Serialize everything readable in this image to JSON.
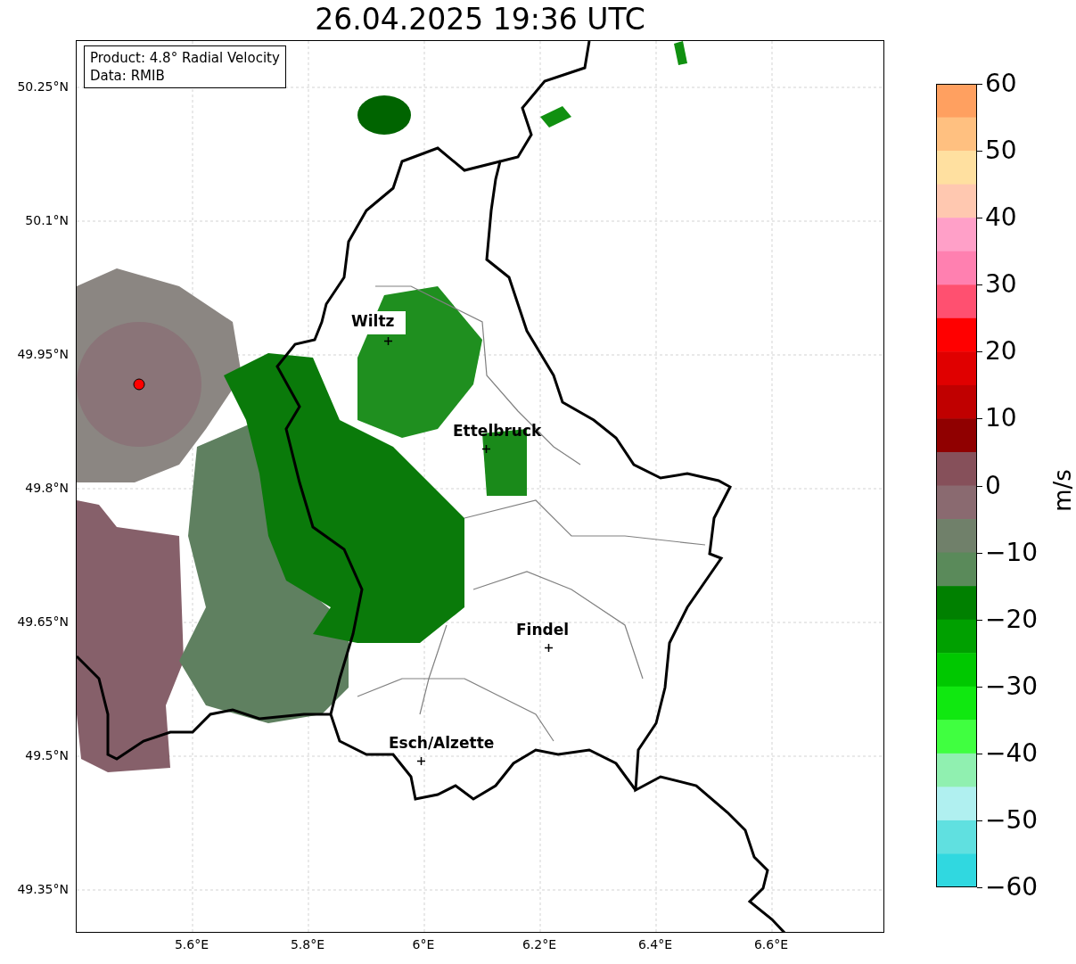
{
  "title": "26.04.2025 19:36 UTC",
  "legend": {
    "lines": [
      "Product: 4.8° Radial Velocity",
      "Data: RMIB"
    ]
  },
  "map": {
    "cities": [
      {
        "name": "Wiltz"
      },
      {
        "name": "Ettelbruck"
      },
      {
        "name": "Findel"
      },
      {
        "name": "Esch/Alzette"
      }
    ]
  },
  "x_axis": {
    "ticks": [
      "5.6°E",
      "5.8°E",
      "6°E",
      "6.2°E",
      "6.4°E",
      "6.6°E"
    ]
  },
  "y_axis": {
    "ticks": [
      "50.25°N",
      "50.1°N",
      "49.95°N",
      "49.8°N",
      "49.65°N",
      "49.5°N",
      "49.35°N"
    ]
  },
  "colorbar": {
    "label": "m/s",
    "ticks": [
      "60",
      "50",
      "40",
      "30",
      "20",
      "10",
      "0",
      "−10",
      "−20",
      "−30",
      "−40",
      "−50",
      "−60"
    ]
  }
}
